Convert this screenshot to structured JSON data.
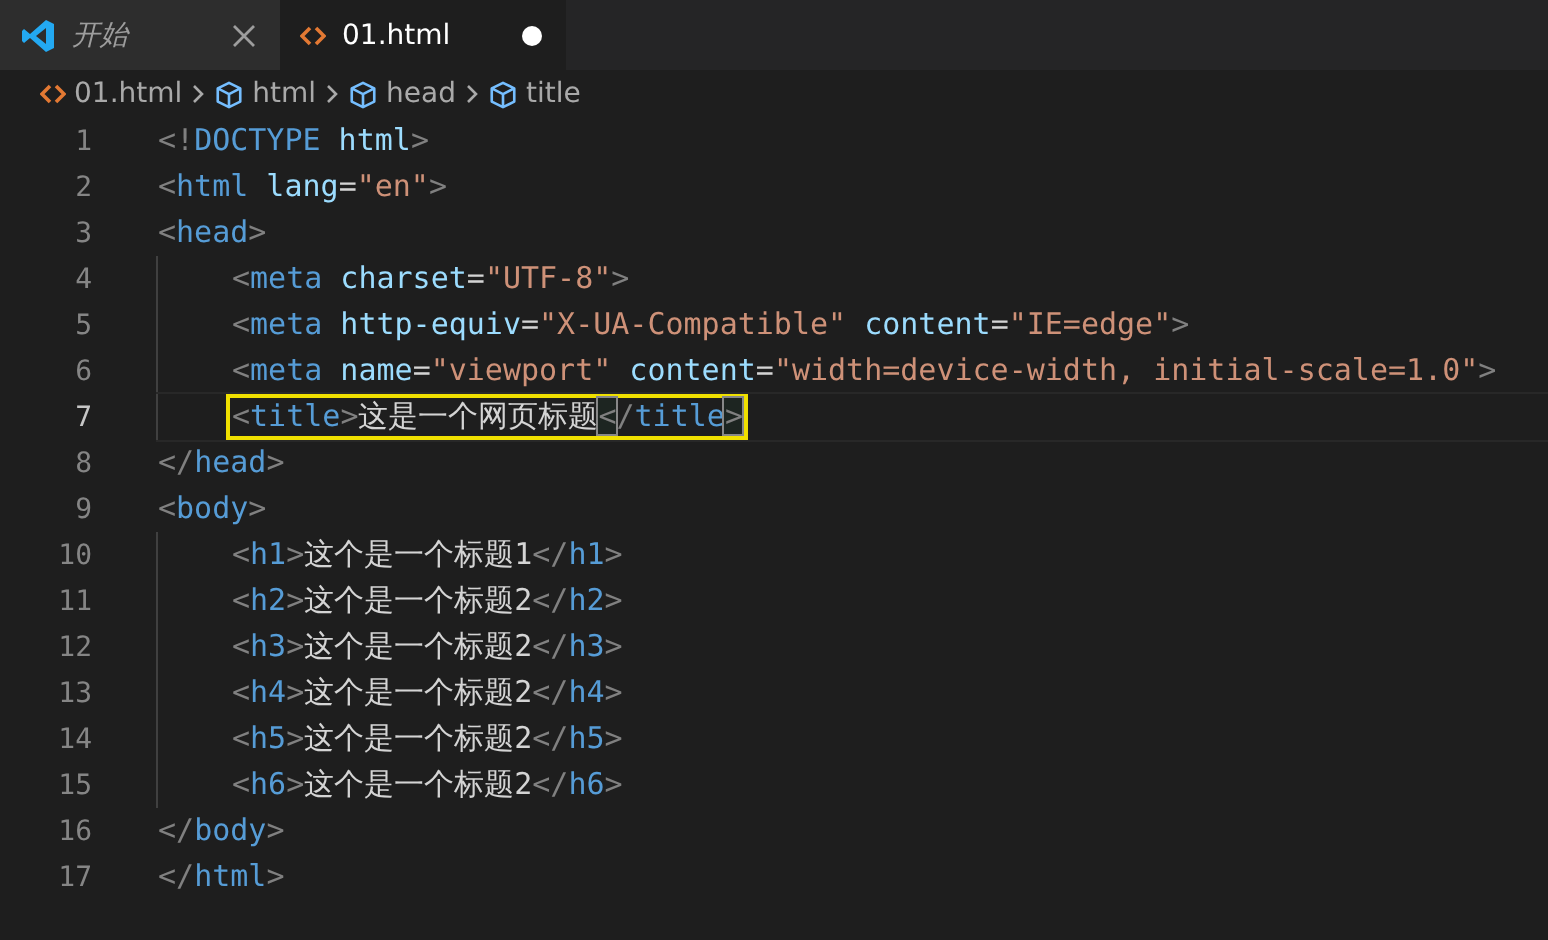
{
  "tabs": [
    {
      "kind": "vscode",
      "label": "开始",
      "italic": true,
      "selected": false,
      "modified": false
    },
    {
      "kind": "html",
      "label": "01.html",
      "italic": false,
      "selected": true,
      "modified": true
    }
  ],
  "breadcrumb": [
    {
      "kind": "file",
      "label": "01.html"
    },
    {
      "kind": "symbol",
      "label": "html"
    },
    {
      "kind": "symbol",
      "label": "head"
    },
    {
      "kind": "symbol",
      "label": "title"
    }
  ],
  "lines": [
    {
      "number": "1",
      "indented": false,
      "current": false,
      "tokens": [
        {
          "kind": "punct",
          "text": "<!"
        },
        {
          "kind": "tag",
          "text": "DOCTYPE"
        },
        {
          "kind": "attr",
          "text": " html"
        },
        {
          "kind": "punct",
          "text": ">"
        }
      ]
    },
    {
      "number": "2",
      "indented": false,
      "current": false,
      "tokens": [
        {
          "kind": "punct",
          "text": "<"
        },
        {
          "kind": "tag",
          "text": "html"
        },
        {
          "kind": "attr",
          "text": " lang"
        },
        {
          "kind": "text",
          "text": "="
        },
        {
          "kind": "string",
          "text": "\"en\""
        },
        {
          "kind": "punct",
          "text": ">"
        }
      ]
    },
    {
      "number": "3",
      "indented": false,
      "current": false,
      "tokens": [
        {
          "kind": "punct",
          "text": "<"
        },
        {
          "kind": "tag",
          "text": "head"
        },
        {
          "kind": "punct",
          "text": ">"
        }
      ]
    },
    {
      "number": "4",
      "indented": true,
      "current": false,
      "tokens": [
        {
          "kind": "punct",
          "text": "<"
        },
        {
          "kind": "tag",
          "text": "meta"
        },
        {
          "kind": "attr",
          "text": " charset"
        },
        {
          "kind": "text",
          "text": "="
        },
        {
          "kind": "string",
          "text": "\"UTF-8\""
        },
        {
          "kind": "punct",
          "text": ">"
        }
      ]
    },
    {
      "number": "5",
      "indented": true,
      "current": false,
      "tokens": [
        {
          "kind": "punct",
          "text": "<"
        },
        {
          "kind": "tag",
          "text": "meta"
        },
        {
          "kind": "attr",
          "text": " http-equiv"
        },
        {
          "kind": "text",
          "text": "="
        },
        {
          "kind": "string",
          "text": "\"X-UA-Compatible\""
        },
        {
          "kind": "attr",
          "text": " content"
        },
        {
          "kind": "text",
          "text": "="
        },
        {
          "kind": "string",
          "text": "\"IE=edge\""
        },
        {
          "kind": "punct",
          "text": ">"
        }
      ]
    },
    {
      "number": "6",
      "indented": true,
      "current": false,
      "tokens": [
        {
          "kind": "punct",
          "text": "<"
        },
        {
          "kind": "tag",
          "text": "meta"
        },
        {
          "kind": "attr",
          "text": " name"
        },
        {
          "kind": "text",
          "text": "="
        },
        {
          "kind": "string",
          "text": "\"viewport\""
        },
        {
          "kind": "attr",
          "text": " content"
        },
        {
          "kind": "text",
          "text": "="
        },
        {
          "kind": "string",
          "text": "\"width=device-width, initial-scale=1.0\""
        },
        {
          "kind": "punct",
          "text": ">"
        }
      ]
    },
    {
      "number": "7",
      "indented": true,
      "current": true,
      "tokens": [
        {
          "kind": "punct",
          "text": "<"
        },
        {
          "kind": "tag",
          "text": "title"
        },
        {
          "kind": "punct",
          "text": ">"
        },
        {
          "kind": "text",
          "text": "这是一个网页标题"
        },
        {
          "kind": "punct",
          "text": "<",
          "boxed": true
        },
        {
          "kind": "punct",
          "text": "/"
        },
        {
          "kind": "tag",
          "text": "title"
        },
        {
          "kind": "punct",
          "text": ">",
          "boxed": true
        }
      ]
    },
    {
      "number": "8",
      "indented": false,
      "current": false,
      "tokens": [
        {
          "kind": "punct",
          "text": "</"
        },
        {
          "kind": "tag",
          "text": "head"
        },
        {
          "kind": "punct",
          "text": ">"
        }
      ]
    },
    {
      "number": "9",
      "indented": false,
      "current": false,
      "tokens": [
        {
          "kind": "punct",
          "text": "<"
        },
        {
          "kind": "tag",
          "text": "body"
        },
        {
          "kind": "punct",
          "text": ">"
        }
      ]
    },
    {
      "number": "10",
      "indented": true,
      "current": false,
      "tokens": [
        {
          "kind": "punct",
          "text": "<"
        },
        {
          "kind": "tag",
          "text": "h1"
        },
        {
          "kind": "punct",
          "text": ">"
        },
        {
          "kind": "text",
          "text": "这个是一个标题1"
        },
        {
          "kind": "punct",
          "text": "</"
        },
        {
          "kind": "tag",
          "text": "h1"
        },
        {
          "kind": "punct",
          "text": ">"
        }
      ]
    },
    {
      "number": "11",
      "indented": true,
      "current": false,
      "tokens": [
        {
          "kind": "punct",
          "text": "<"
        },
        {
          "kind": "tag",
          "text": "h2"
        },
        {
          "kind": "punct",
          "text": ">"
        },
        {
          "kind": "text",
          "text": "这个是一个标题2"
        },
        {
          "kind": "punct",
          "text": "</"
        },
        {
          "kind": "tag",
          "text": "h2"
        },
        {
          "kind": "punct",
          "text": ">"
        }
      ]
    },
    {
      "number": "12",
      "indented": true,
      "current": false,
      "tokens": [
        {
          "kind": "punct",
          "text": "<"
        },
        {
          "kind": "tag",
          "text": "h3"
        },
        {
          "kind": "punct",
          "text": ">"
        },
        {
          "kind": "text",
          "text": "这个是一个标题2"
        },
        {
          "kind": "punct",
          "text": "</"
        },
        {
          "kind": "tag",
          "text": "h3"
        },
        {
          "kind": "punct",
          "text": ">"
        }
      ]
    },
    {
      "number": "13",
      "indented": true,
      "current": false,
      "tokens": [
        {
          "kind": "punct",
          "text": "<"
        },
        {
          "kind": "tag",
          "text": "h4"
        },
        {
          "kind": "punct",
          "text": ">"
        },
        {
          "kind": "text",
          "text": "这个是一个标题2"
        },
        {
          "kind": "punct",
          "text": "</"
        },
        {
          "kind": "tag",
          "text": "h4"
        },
        {
          "kind": "punct",
          "text": ">"
        }
      ]
    },
    {
      "number": "14",
      "indented": true,
      "current": false,
      "tokens": [
        {
          "kind": "punct",
          "text": "<"
        },
        {
          "kind": "tag",
          "text": "h5"
        },
        {
          "kind": "punct",
          "text": ">"
        },
        {
          "kind": "text",
          "text": "这个是一个标题2"
        },
        {
          "kind": "punct",
          "text": "</"
        },
        {
          "kind": "tag",
          "text": "h5"
        },
        {
          "kind": "punct",
          "text": ">"
        }
      ]
    },
    {
      "number": "15",
      "indented": true,
      "current": false,
      "tokens": [
        {
          "kind": "punct",
          "text": "<"
        },
        {
          "kind": "tag",
          "text": "h6"
        },
        {
          "kind": "punct",
          "text": ">"
        },
        {
          "kind": "text",
          "text": "这个是一个标题2"
        },
        {
          "kind": "punct",
          "text": "</"
        },
        {
          "kind": "tag",
          "text": "h6"
        },
        {
          "kind": "punct",
          "text": ">"
        }
      ]
    },
    {
      "number": "16",
      "indented": false,
      "current": false,
      "tokens": [
        {
          "kind": "punct",
          "text": "</"
        },
        {
          "kind": "tag",
          "text": "body"
        },
        {
          "kind": "punct",
          "text": ">"
        }
      ]
    },
    {
      "number": "17",
      "indented": false,
      "current": false,
      "tokens": [
        {
          "kind": "punct",
          "text": "</"
        },
        {
          "kind": "tag",
          "text": "html"
        },
        {
          "kind": "punct",
          "text": ">"
        }
      ]
    }
  ]
}
